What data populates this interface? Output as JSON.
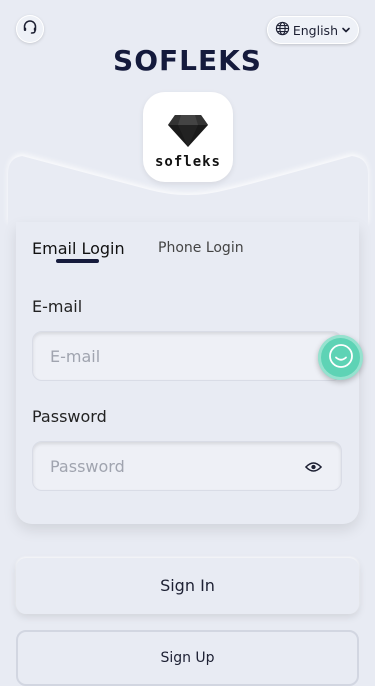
{
  "header": {
    "support_icon": "headset-icon",
    "language": {
      "icon": "globe-icon",
      "label": "English",
      "caret": "chevron-down-icon"
    }
  },
  "brand": {
    "title": "SOFLEKS",
    "logo_text": "sofleks",
    "logo_icon": "diamond-icon"
  },
  "tabs": [
    {
      "label": "Email Login",
      "active": true
    },
    {
      "label": "Phone Login",
      "active": false
    }
  ],
  "form": {
    "email": {
      "label": "E-mail",
      "placeholder": "E-mail",
      "value": ""
    },
    "password": {
      "label": "Password",
      "placeholder": "Password",
      "value": "",
      "toggle_icon": "eye-icon"
    }
  },
  "chat_icon": "smiley-chat-icon",
  "buttons": {
    "sign_in": "Sign In",
    "sign_up": "Sign Up"
  },
  "colors": {
    "background": "#e8ebf3",
    "brand": "#141a3c",
    "accent": "#161b3c",
    "chat": "#5ed3b5"
  }
}
